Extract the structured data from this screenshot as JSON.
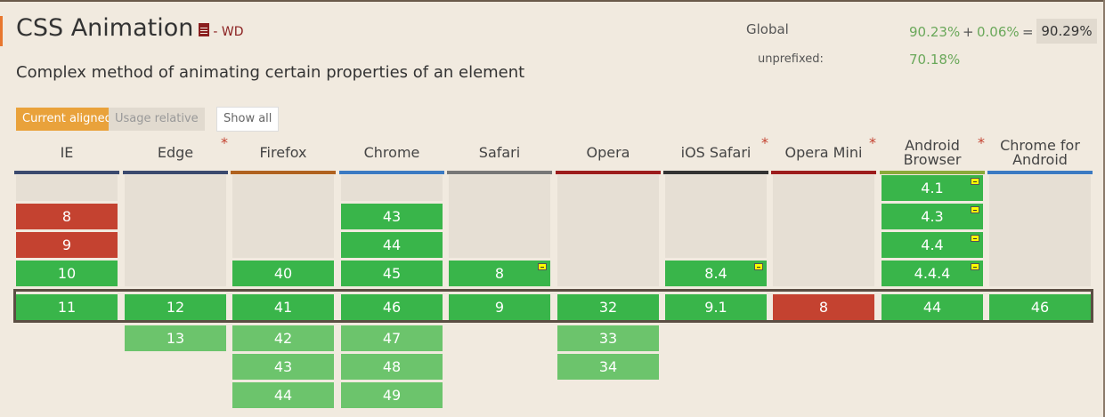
{
  "feature": {
    "title": "CSS Animation",
    "status": "- WD",
    "description": "Complex method of animating certain properties of an element"
  },
  "stats": {
    "global_label": "Global",
    "global_supported": "90.23%",
    "plus": "+",
    "global_partial": "0.06%",
    "equals": "=",
    "global_total": "90.29%",
    "unprefixed_label": "unprefixed:",
    "unprefixed_value": "70.18%"
  },
  "buttons": {
    "current_aligned": "Current aligned",
    "usage_relative": "Usage relative",
    "show_all": "Show all"
  },
  "colors": {
    "supported": "#39b54a",
    "not_supported": "#c44230",
    "future": "#6cc46c",
    "accent": "#e9a23b"
  },
  "browsers": [
    {
      "name": [
        "IE"
      ],
      "star": "",
      "bar": "#3b4a6e",
      "past": [
        {
          "v": "",
          "s": "u"
        },
        {
          "v": "8",
          "s": "n"
        },
        {
          "v": "9",
          "s": "n"
        },
        {
          "v": "10",
          "s": "y"
        }
      ],
      "current": {
        "v": "11",
        "s": "y"
      },
      "future": []
    },
    {
      "name": [
        "Edge"
      ],
      "star": "*",
      "bar": "#3b4a6e",
      "past": [
        {
          "v": "",
          "s": "u",
          "tall": true
        }
      ],
      "current": {
        "v": "12",
        "s": "y"
      },
      "future": [
        {
          "v": "13"
        }
      ]
    },
    {
      "name": [
        "Firefox"
      ],
      "star": "",
      "bar": "#b0621f",
      "past": [
        {
          "v": "",
          "s": "u",
          "tall3": true
        },
        {
          "v": "40",
          "s": "y"
        }
      ],
      "current": {
        "v": "41",
        "s": "y"
      },
      "future": [
        {
          "v": "42"
        },
        {
          "v": "43"
        },
        {
          "v": "44"
        }
      ]
    },
    {
      "name": [
        "Chrome"
      ],
      "star": "",
      "bar": "#3b7ac2",
      "past": [
        {
          "v": "",
          "s": "u"
        },
        {
          "v": "43",
          "s": "y"
        },
        {
          "v": "44",
          "s": "y"
        },
        {
          "v": "45",
          "s": "y"
        }
      ],
      "current": {
        "v": "46",
        "s": "y"
      },
      "future": [
        {
          "v": "47"
        },
        {
          "v": "48"
        },
        {
          "v": "49"
        }
      ]
    },
    {
      "name": [
        "Safari"
      ],
      "star": "",
      "bar": "#777777",
      "past": [
        {
          "v": "",
          "s": "u",
          "tall3": true
        },
        {
          "v": "8",
          "s": "y",
          "note": true
        }
      ],
      "current": {
        "v": "9",
        "s": "y"
      },
      "future": []
    },
    {
      "name": [
        "Opera"
      ],
      "star": "",
      "bar": "#9c1c1c",
      "past": [
        {
          "v": "",
          "s": "u",
          "tall": true
        }
      ],
      "current": {
        "v": "32",
        "s": "y"
      },
      "future": [
        {
          "v": "33"
        },
        {
          "v": "34"
        }
      ]
    },
    {
      "name": [
        "iOS Safari"
      ],
      "star": "*",
      "bar": "#333333",
      "past": [
        {
          "v": "",
          "s": "u",
          "tall3": true
        },
        {
          "v": "8.4",
          "s": "y",
          "note": true
        }
      ],
      "current": {
        "v": "9.1",
        "s": "y"
      },
      "future": []
    },
    {
      "name": [
        "Opera Mini"
      ],
      "star": "*",
      "bar": "#9c1c1c",
      "past": [
        {
          "v": "",
          "s": "u",
          "tall": true
        }
      ],
      "current": {
        "v": "8",
        "s": "n"
      },
      "future": []
    },
    {
      "name": [
        "Android",
        "Browser"
      ],
      "star": "*",
      "bar": "#8aaa3a",
      "past": [
        {
          "v": "4.1",
          "s": "y",
          "note": true
        },
        {
          "v": "4.3",
          "s": "y",
          "note": true
        },
        {
          "v": "4.4",
          "s": "y",
          "note": true
        },
        {
          "v": "4.4.4",
          "s": "y",
          "note": true
        }
      ],
      "current": {
        "v": "44",
        "s": "y"
      },
      "future": []
    },
    {
      "name": [
        "Chrome for",
        "Android"
      ],
      "star": "",
      "bar": "#3b7ac2",
      "past": [
        {
          "v": "",
          "s": "u",
          "tall": true
        }
      ],
      "current": {
        "v": "46",
        "s": "y"
      },
      "future": []
    }
  ]
}
